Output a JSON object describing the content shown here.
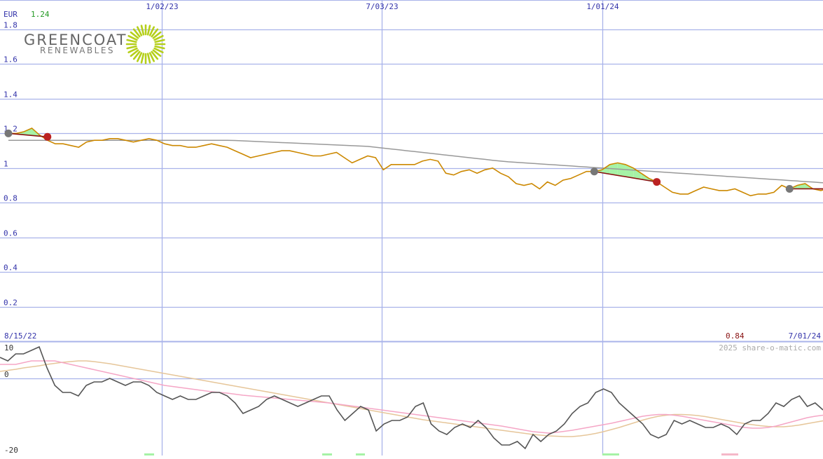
{
  "chart_data": [
    {
      "type": "line",
      "currency": "EUR",
      "last_high_label": "1.24",
      "last_low_label": "0.84",
      "start_date_label": "8/15/22",
      "end_date_label": "7/01/24",
      "watermark": "2025 share-o-matic.com",
      "date_ticks": [
        "1/02/23",
        "7/03/23",
        "1/01/24"
      ],
      "y_ticks": [
        "1.8",
        "1.6",
        "1.4",
        "1.2",
        "1",
        "0.8",
        "0.6",
        "0.4",
        "0.2"
      ],
      "ylim": [
        0,
        1.97
      ],
      "grid": true,
      "series": [
        {
          "role": "price",
          "values": [
            1.2,
            1.2,
            1.21,
            1.23,
            1.19,
            1.16,
            1.14,
            1.14,
            1.13,
            1.12,
            1.15,
            1.16,
            1.16,
            1.17,
            1.17,
            1.16,
            1.15,
            1.16,
            1.17,
            1.16,
            1.14,
            1.13,
            1.13,
            1.12,
            1.12,
            1.13,
            1.14,
            1.13,
            1.12,
            1.1,
            1.08,
            1.06,
            1.07,
            1.08,
            1.09,
            1.1,
            1.1,
            1.09,
            1.08,
            1.07,
            1.07,
            1.08,
            1.09,
            1.06,
            1.03,
            1.05,
            1.07,
            1.06,
            0.99,
            1.02,
            1.02,
            1.02,
            1.02,
            1.04,
            1.05,
            1.04,
            0.97,
            0.96,
            0.98,
            0.99,
            0.97,
            0.99,
            1.0,
            0.97,
            0.95,
            0.91,
            0.9,
            0.91,
            0.88,
            0.92,
            0.9,
            0.93,
            0.94,
            0.96,
            0.98,
            0.98,
            0.99,
            1.02,
            1.03,
            1.02,
            1.0,
            0.97,
            0.94,
            0.92,
            0.89,
            0.86,
            0.85,
            0.85,
            0.87,
            0.89,
            0.88,
            0.87,
            0.87,
            0.88,
            0.86,
            0.84,
            0.85,
            0.85,
            0.86,
            0.9,
            0.88,
            0.9,
            0.91,
            0.88,
            0.87,
            0.88
          ]
        },
        {
          "role": "long-term average",
          "values": [
            1.16,
            1.16,
            1.16,
            1.16,
            1.16,
            1.16,
            1.16,
            1.16,
            1.16,
            1.16,
            1.16,
            1.16,
            1.16,
            1.16,
            1.16,
            1.16,
            1.16,
            1.16,
            1.16,
            1.16,
            1.16,
            1.16,
            1.16,
            1.16,
            1.16,
            1.16,
            1.16,
            1.16,
            1.16,
            1.159,
            1.157,
            1.155,
            1.153,
            1.151,
            1.149,
            1.147,
            1.145,
            1.143,
            1.141,
            1.139,
            1.137,
            1.135,
            1.133,
            1.131,
            1.129,
            1.127,
            1.125,
            1.12,
            1.115,
            1.11,
            1.105,
            1.1,
            1.095,
            1.09,
            1.085,
            1.08,
            1.075,
            1.07,
            1.065,
            1.06,
            1.055,
            1.05,
            1.045,
            1.04,
            1.036,
            1.033,
            1.03,
            1.027,
            1.024,
            1.021,
            1.018,
            1.015,
            1.012,
            1.009,
            1.006,
            1.003,
            1.0,
            0.997,
            0.994,
            0.991,
            0.988,
            0.985,
            0.982,
            0.979,
            0.976,
            0.973,
            0.97,
            0.967,
            0.964,
            0.961,
            0.958,
            0.955,
            0.952,
            0.949,
            0.946,
            0.943,
            0.94,
            0.937,
            0.934,
            0.931,
            0.928,
            0.925,
            0.922,
            0.919,
            0.916,
            0.913
          ]
        }
      ],
      "signals": [
        {
          "kind": "buy",
          "start_index": 0,
          "end_index": 5,
          "start_value": 1.2,
          "end_value": 1.18
        },
        {
          "kind": "buy",
          "start_index": 75,
          "end_index": 83,
          "start_value": 0.98,
          "end_value": 0.92
        },
        {
          "kind": "buy",
          "start_index": 100,
          "end_index": 105,
          "start_value": 0.88,
          "end_value": 0.88
        }
      ]
    },
    {
      "type": "line",
      "y_ticks": [
        "10",
        "0",
        "-20"
      ],
      "ylim": [
        -20,
        10
      ],
      "series": [
        {
          "role": "oscillator",
          "values": [
            6,
            5,
            7,
            7,
            8,
            9,
            3,
            -2,
            -4,
            -4,
            -5,
            -2,
            -1,
            -1,
            0,
            -1,
            -2,
            -1,
            -1,
            -2,
            -4,
            -5,
            -6,
            -5,
            -6,
            -6,
            -5,
            -4,
            -4,
            -5,
            -7,
            -10,
            -9,
            -8,
            -6,
            -5,
            -6,
            -7,
            -8,
            -7,
            -6,
            -5,
            -5,
            -9,
            -12,
            -10,
            -8,
            -9,
            -15,
            -13,
            -12,
            -12,
            -11,
            -8,
            -7,
            -13,
            -15,
            -16,
            -14,
            -13,
            -14,
            -12,
            -14,
            -17,
            -19,
            -19,
            -18,
            -20,
            -16,
            -18,
            -16,
            -15,
            -13,
            -10,
            -8,
            -7,
            -4,
            -3,
            -4,
            -7,
            -9,
            -11,
            -13,
            -16,
            -17,
            -16,
            -12,
            -13,
            -12,
            -13,
            -14,
            -14,
            -13,
            -14,
            -16,
            -13,
            -12,
            -12,
            -10,
            -7,
            -8,
            -6,
            -5,
            -8,
            -7,
            -9
          ]
        },
        {
          "role": "signal line",
          "values": [
            4,
            4,
            4,
            4.5,
            5,
            5,
            5,
            5,
            4.5,
            4,
            3.5,
            3,
            2.5,
            2,
            1.5,
            1,
            0.5,
            0,
            -0.5,
            -1,
            -1.5,
            -2,
            -2.3,
            -2.6,
            -2.9,
            -3.2,
            -3.5,
            -3.8,
            -4,
            -4.2,
            -4.5,
            -4.8,
            -5,
            -5.2,
            -5.4,
            -5.6,
            -5.8,
            -6,
            -6.2,
            -6.4,
            -6.6,
            -6.8,
            -7,
            -7.3,
            -7.6,
            -7.9,
            -8.2,
            -8.5,
            -8.8,
            -9.1,
            -9.4,
            -9.7,
            -10,
            -10.3,
            -10.6,
            -10.9,
            -11.2,
            -11.5,
            -11.8,
            -12.1,
            -12.4,
            -12.7,
            -13,
            -13.3,
            -13.6,
            -14,
            -14.4,
            -14.8,
            -15.2,
            -15.4,
            -15.6,
            -15.4,
            -15.1,
            -14.8,
            -14.4,
            -14,
            -13.6,
            -13.2,
            -12.8,
            -12.3,
            -11.8,
            -11.3,
            -10.8,
            -10.5,
            -10.3,
            -10.3,
            -10.5,
            -10.8,
            -11.2,
            -11.6,
            -12,
            -12.4,
            -12.8,
            -13.2,
            -13.6,
            -14,
            -14.2,
            -14.2,
            -14,
            -13.6,
            -13,
            -12.4,
            -11.8,
            -11.2,
            -10.8,
            -10.5
          ]
        },
        {
          "role": "slow line",
          "values": [
            2,
            2.3,
            2.6,
            3,
            3.3,
            3.6,
            4,
            4.3,
            4.6,
            4.8,
            5,
            5,
            4.8,
            4.5,
            4.2,
            3.8,
            3.4,
            3,
            2.6,
            2.2,
            1.8,
            1.4,
            1,
            0.6,
            0.2,
            -0.2,
            -0.6,
            -1,
            -1.4,
            -1.8,
            -2.2,
            -2.6,
            -3,
            -3.4,
            -3.8,
            -4.2,
            -4.6,
            -5,
            -5.4,
            -5.8,
            -6.2,
            -6.6,
            -7,
            -7.4,
            -7.8,
            -8.2,
            -8.6,
            -9,
            -9.4,
            -9.8,
            -10.2,
            -10.6,
            -11,
            -11.4,
            -11.8,
            -12.1,
            -12.4,
            -12.7,
            -13,
            -13.3,
            -13.6,
            -13.9,
            -14.2,
            -14.5,
            -14.8,
            -15.1,
            -15.4,
            -15.7,
            -16,
            -16.2,
            -16.4,
            -16.5,
            -16.6,
            -16.6,
            -16.4,
            -16.1,
            -15.7,
            -15.2,
            -14.6,
            -14,
            -13.3,
            -12.6,
            -11.9,
            -11.3,
            -10.8,
            -10.5,
            -10.3,
            -10.3,
            -10.4,
            -10.6,
            -10.9,
            -11.3,
            -11.7,
            -12.1,
            -12.5,
            -12.9,
            -13.2,
            -13.5,
            -13.7,
            -13.8,
            -13.8,
            -13.6,
            -13.3,
            -12.9,
            -12.5,
            -12.1
          ]
        }
      ]
    }
  ],
  "logo": {
    "name": "GREENCOAT",
    "tagline": "RENEWABLES"
  },
  "colors": {
    "grid": "#a9b3ea",
    "axis_text": "#3333aa",
    "price": "#cc8800",
    "long_avg": "#999999",
    "trend_line": "#881111",
    "start_dot": "#777777",
    "end_dot": "#bb2222",
    "gain_fill": "#a6f2a6",
    "loss_fill": "#f5b8c8",
    "high_label": "#229922",
    "low_label": "#881111",
    "oscillator": "#555555",
    "signal": "#f5a6c6",
    "slow": "#e6c69a",
    "logo_green": "#b5cf1a",
    "logo_text": "#666666"
  }
}
